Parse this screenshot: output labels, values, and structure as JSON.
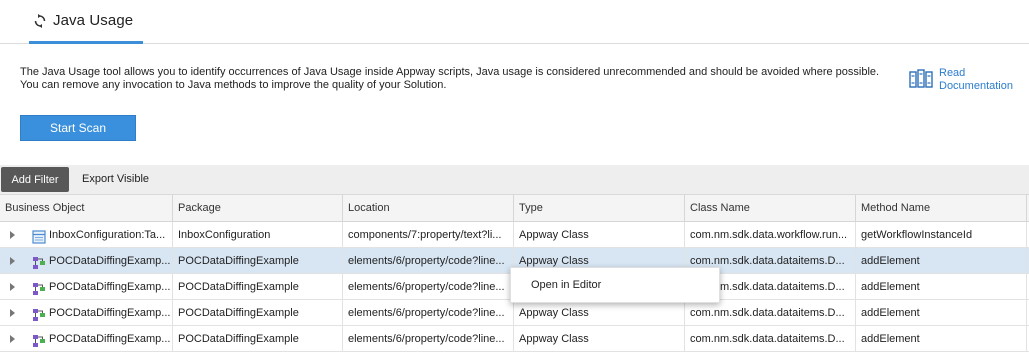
{
  "tab": {
    "label": "Java Usage",
    "icon": "refresh-icon"
  },
  "description": "The Java Usage tool allows you to identify occurrences of Java Usage inside Appway scripts, Java usage is considered unrecommended and should be avoided where possible. You can remove any invocation to Java methods to improve the quality of your Solution.",
  "read_doc": {
    "line1": "Read",
    "line2": "Documentation",
    "icon": "books-icon"
  },
  "start_scan_label": "Start Scan",
  "toolbar": {
    "add_filter": "Add Filter",
    "export_visible": "Export Visible"
  },
  "columns": [
    "Business Object",
    "Package",
    "Location",
    "Type",
    "Class Name",
    "Method Name"
  ],
  "rows": [
    {
      "icon": "inbox-config-icon",
      "object": "InboxConfiguration:Ta...",
      "package": "InboxConfiguration",
      "location": "components/7:property/text?li...",
      "type": "Appway Class",
      "class_name": "com.nm.sdk.data.workflow.run...",
      "method": "getWorkflowInstanceId"
    },
    {
      "icon": "process-icon",
      "object": "POCDataDiffingExamp...",
      "package": "POCDataDiffingExample",
      "location": "elements/6/property/code?line...",
      "type": "Appway Class",
      "class_name": "com.nm.sdk.data.dataitems.D...",
      "method": "addElement"
    },
    {
      "icon": "process-icon",
      "object": "POCDataDiffingExamp...",
      "package": "POCDataDiffingExample",
      "location": "elements/6/property/code?line...",
      "type": "Appway Class",
      "class_name": "com.nm.sdk.data.dataitems.D...",
      "method": "addElement"
    },
    {
      "icon": "process-icon",
      "object": "POCDataDiffingExamp...",
      "package": "POCDataDiffingExample",
      "location": "elements/6/property/code?line...",
      "type": "Appway Class",
      "class_name": "com.nm.sdk.data.dataitems.D...",
      "method": "addElement"
    },
    {
      "icon": "process-icon",
      "object": "POCDataDiffingExamp...",
      "package": "POCDataDiffingExample",
      "location": "elements/6/property/code?line...",
      "type": "Appway Class",
      "class_name": "com.nm.sdk.data.dataitems.D...",
      "method": "addElement"
    }
  ],
  "context_menu": {
    "open_in_editor": "Open in Editor"
  },
  "colors": {
    "accent": "#3b8fd9",
    "selected_row": "#d8e6f4",
    "add_filter_bg": "#585858",
    "link": "#2a7ccf"
  }
}
